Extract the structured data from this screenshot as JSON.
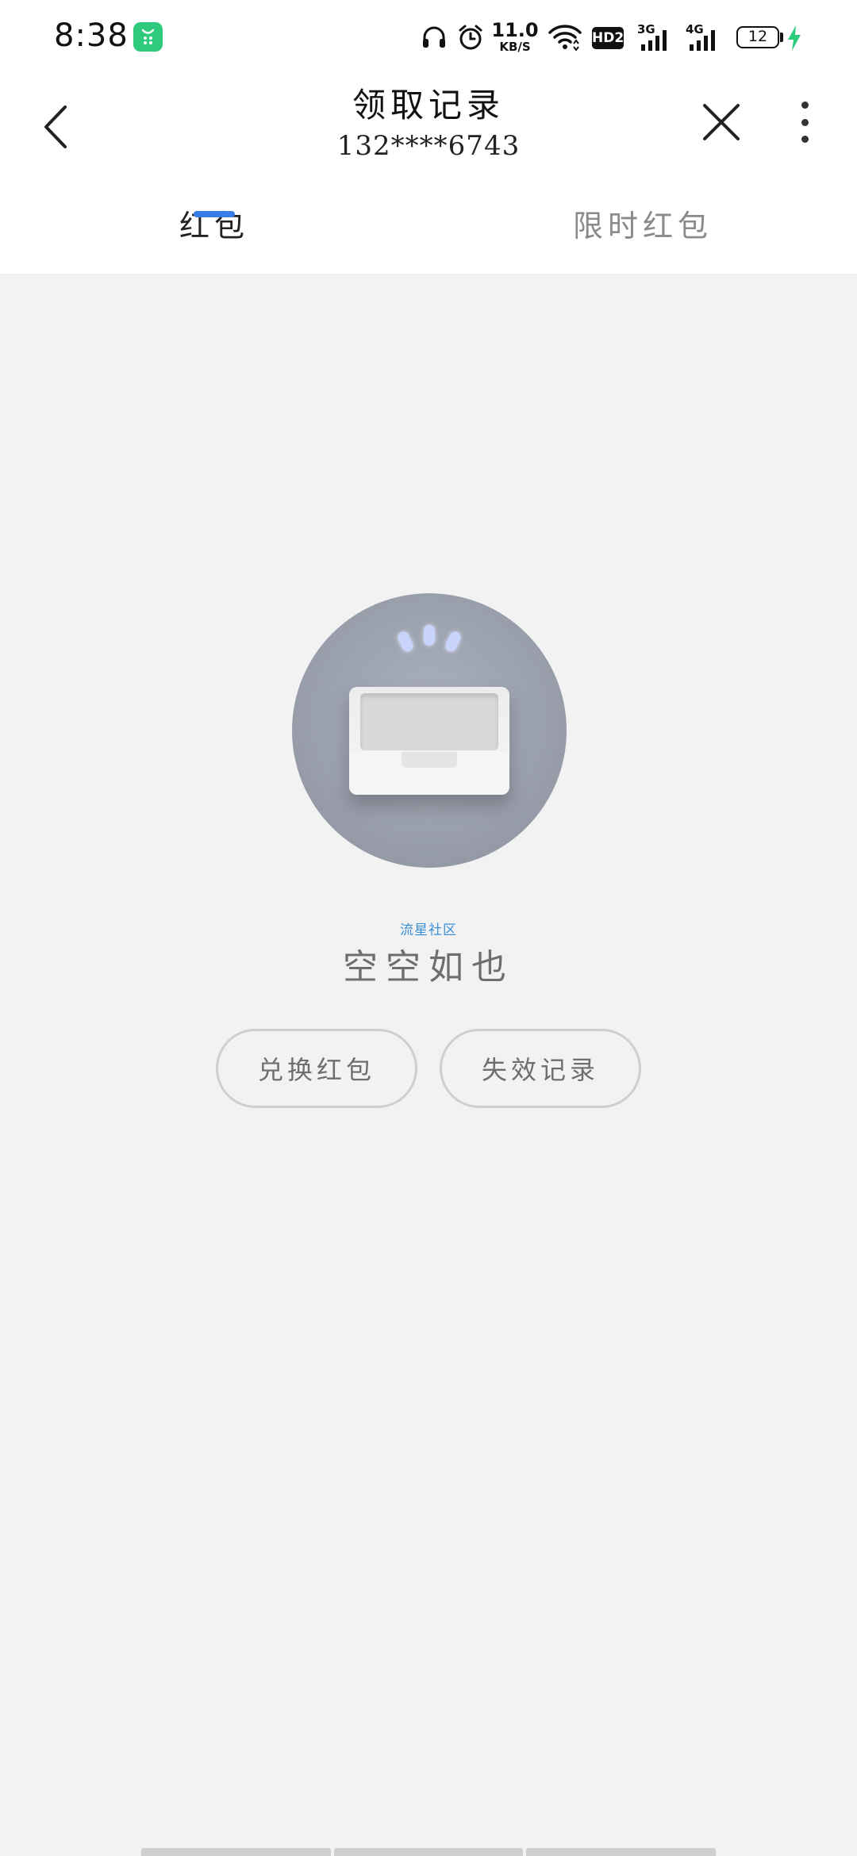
{
  "status_bar": {
    "time": "8:38",
    "app_icon": "green-shopping-app-icon",
    "net_speed_value": "11.0",
    "net_speed_unit": "KB/S",
    "hd_badge": "HD2",
    "network_3g": "3G",
    "network_4g": "4G",
    "battery_level": "12",
    "icons": [
      "headphones-icon",
      "alarm-icon",
      "wifi-icon",
      "signal-icon",
      "charging-icon"
    ],
    "charging_color": "#2ecb7d"
  },
  "header": {
    "title": "领取记录",
    "subtitle": "132****6743",
    "back_icon": "chevron-left-icon",
    "close_icon": "close-icon",
    "more_icon": "more-vertical-icon"
  },
  "tabs": [
    {
      "label": "红包",
      "active": true
    },
    {
      "label": "限时红包",
      "active": false
    }
  ],
  "accent_color": "#3a7bea",
  "empty_state": {
    "illustration": "empty-inbox-tray-icon",
    "watermark": "流星社区",
    "message": "空空如也"
  },
  "actions": {
    "redeem_label": "兑换红包",
    "expired_label": "失效记录"
  }
}
